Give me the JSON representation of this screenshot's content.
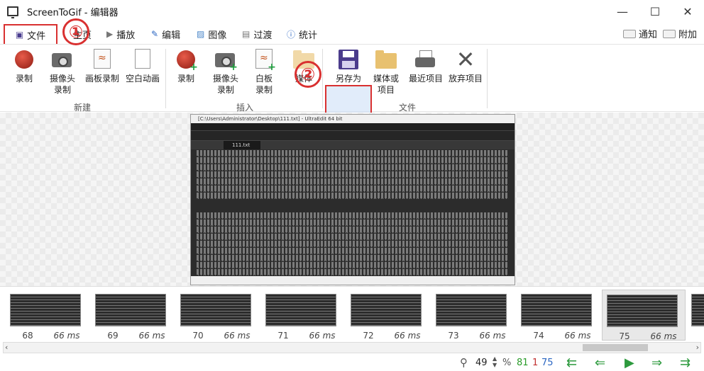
{
  "window": {
    "title": "ScreenToGif - 编辑器",
    "min_glyph": "—",
    "max_glyph": "☐",
    "close_glyph": "✕"
  },
  "tabs": {
    "file": "文件",
    "home": "主页",
    "play": "播放",
    "edit": "编辑",
    "image": "图像",
    "transition": "过渡",
    "stats": "统计"
  },
  "right_actions": {
    "notify": "通知",
    "attach": "附加"
  },
  "callouts": {
    "one": "①",
    "two": "②"
  },
  "ribbon": {
    "groups": {
      "new": "新建",
      "insert": "插入",
      "file": "文件"
    },
    "new": {
      "record": "录制",
      "webcam": "摄像头录制",
      "board": "画板录制",
      "blank": "空白动画"
    },
    "insert": {
      "record": "录制",
      "webcam": "摄像头录制",
      "board": "白板录制",
      "media": "媒体"
    },
    "file": {
      "save_as": "另存为",
      "media_or_project": "媒体或项目",
      "recent": "最近项目",
      "discard": "放弃项目"
    }
  },
  "preview": {
    "window_title": "[C:\\Users\\Administrator\\Desktop\\111.txt] - UltraEdit 64 bit",
    "active_tab": "111.txt"
  },
  "frames": [
    {
      "number": "68",
      "delay": "66 ms"
    },
    {
      "number": "69",
      "delay": "66 ms"
    },
    {
      "number": "70",
      "delay": "66 ms"
    },
    {
      "number": "71",
      "delay": "66 ms"
    },
    {
      "number": "72",
      "delay": "66 ms"
    },
    {
      "number": "73",
      "delay": "66 ms"
    },
    {
      "number": "74",
      "delay": "66 ms"
    },
    {
      "number": "75",
      "delay": "66 ms"
    }
  ],
  "status": {
    "zoom": "49",
    "zoom_unit": "%",
    "frame_total": "81",
    "selected": "1",
    "current": "75"
  },
  "colors": {
    "accent_red": "#d93030",
    "save_purple": "#4b3c8c",
    "nav_green": "#2d9a3e"
  }
}
